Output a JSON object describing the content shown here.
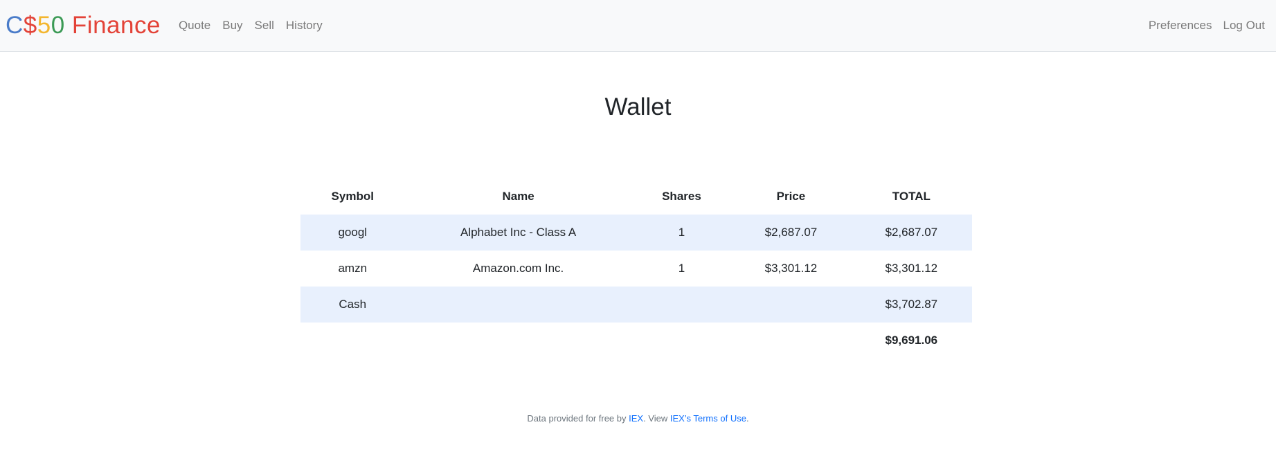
{
  "navbar": {
    "brand": [
      {
        "text": "C",
        "color": "#4a7cc9"
      },
      {
        "text": "$",
        "color": "#e34338"
      },
      {
        "text": "5",
        "color": "#f3b62f"
      },
      {
        "text": "0",
        "color": "#3b9a55"
      },
      {
        "text": " Finance",
        "color": "#e34338"
      }
    ],
    "left_links": [
      "Quote",
      "Buy",
      "Sell",
      "History"
    ],
    "right_links": [
      "Preferences",
      "Log Out"
    ]
  },
  "main": {
    "title": "Wallet",
    "columns": [
      "Symbol",
      "Name",
      "Shares",
      "Price",
      "TOTAL"
    ],
    "rows": [
      {
        "symbol": "googl",
        "name": "Alphabet Inc - Class A",
        "shares": "1",
        "price": "$2,687.07",
        "total": "$2,687.07"
      },
      {
        "symbol": "amzn",
        "name": "Amazon.com Inc.",
        "shares": "1",
        "price": "$3,301.12",
        "total": "$3,301.12"
      }
    ],
    "cash": {
      "label": "Cash",
      "total": "$3,702.87"
    },
    "grand_total": "$9,691.06"
  },
  "footer": {
    "prefix": "Data provided for free by ",
    "iex_link": "IEX",
    "middle": ". View ",
    "terms_link": "IEX’s Terms of Use",
    "suffix": "."
  }
}
